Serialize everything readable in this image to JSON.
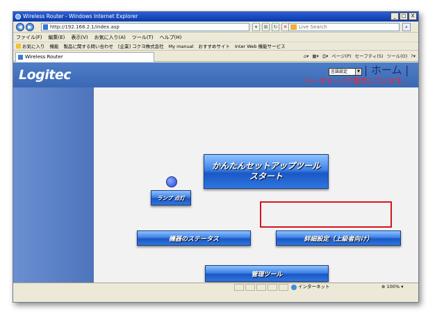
{
  "window": {
    "title": "Wireless Router - Windows Internet Explorer",
    "controls": [
      "_",
      "□",
      "X"
    ]
  },
  "addressbar": {
    "url": "http://192.168.2.1/index.asp",
    "search_placeholder": "Live Search"
  },
  "menu": [
    "ファイル(F)",
    "編集(E)",
    "表示(V)",
    "お気に入り(A)",
    "ツール(T)",
    "ヘルプ(H)"
  ],
  "favorites": [
    "お気に入り",
    "機能",
    "製品に関する問い合わせ",
    "[企業] コクヨ株式会社",
    "My manual",
    "おすすめサイト",
    "Inter Web 機能サービス"
  ],
  "tab": {
    "label": "Wireless Router"
  },
  "commandbar": [
    "ページ(P)",
    "セーフティ(S)",
    "ツール(O)"
  ],
  "header": {
    "logo": "Logitec",
    "language": "言語設定",
    "home": "| ホーム |",
    "mode": "ルータモードで動作しています。"
  },
  "buttons": {
    "setup_line1": "かんたんセットアップツール",
    "setup_line2": "スタート",
    "lamp": "ランプ 点灯",
    "status": "機器のステータス",
    "advanced": "詳細設定（上級者向け）",
    "admin": "管理ツール"
  },
  "statusbar": {
    "zone": "インターネット",
    "zoom": "100%"
  },
  "colors": {
    "header_blue": "#3a68b4",
    "mode_text": "#ff2020",
    "highlight_box": "#d8131b"
  }
}
